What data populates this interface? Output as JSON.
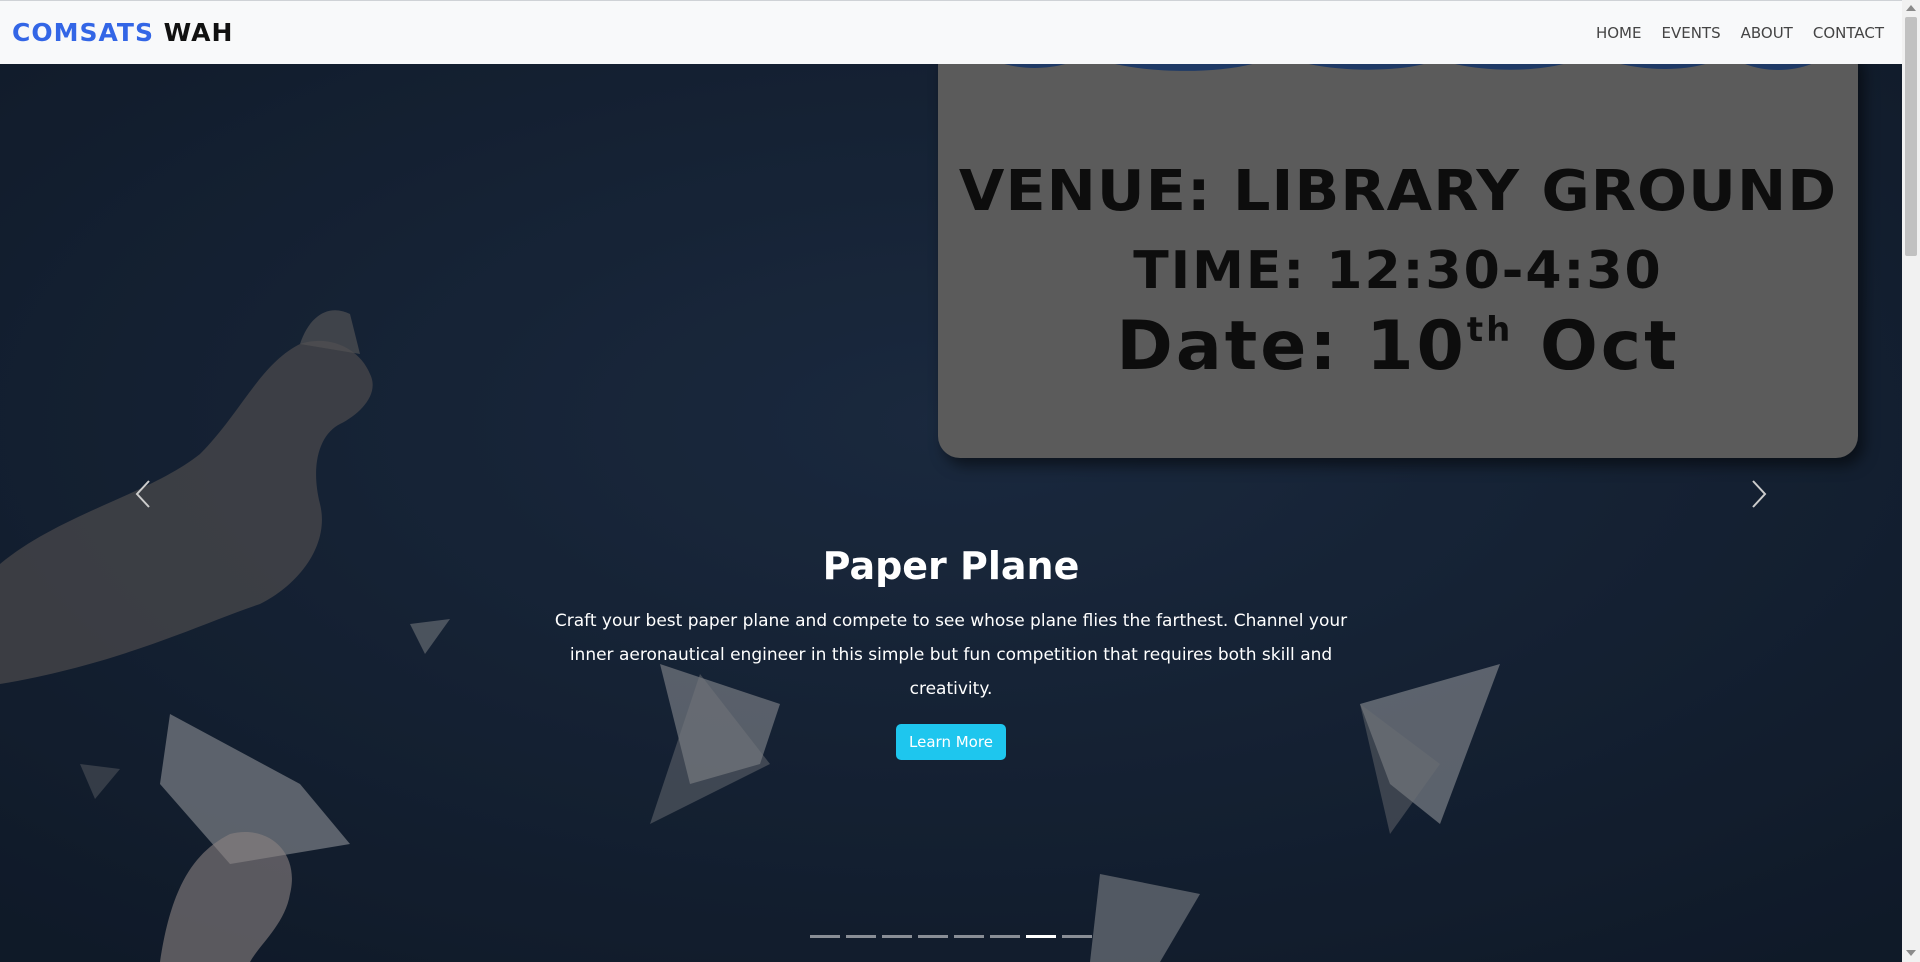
{
  "navbar": {
    "brand_primary": "COMSATS",
    "brand_secondary": "WAH",
    "links": [
      {
        "label": "HOME"
      },
      {
        "label": "EVENTS"
      },
      {
        "label": "ABOUT"
      },
      {
        "label": "CONTACT"
      }
    ]
  },
  "carousel": {
    "poster": {
      "venue": "VENUE: LIBRARY GROUND",
      "time": "TIME: 12:30-4:30",
      "date_prefix": "Date: 10",
      "date_sup": "th",
      "date_suffix": " Oct"
    },
    "caption_title": "Paper Plane",
    "caption_text": "Craft your best paper plane and compete to see whose plane flies the farthest. Channel your inner aeronautical engineer in this simple but fun competition that requires both skill and creativity.",
    "button_label": "Learn More",
    "prev_icon": "chevron-left-icon",
    "next_icon": "chevron-right-icon",
    "slide_count": 8,
    "active_slide": 7
  },
  "colors": {
    "brand_primary": "#3366e6",
    "brand_secondary": "#111111",
    "button_bg": "#1ec6ee",
    "hero_bg": "#1b2a3c"
  }
}
